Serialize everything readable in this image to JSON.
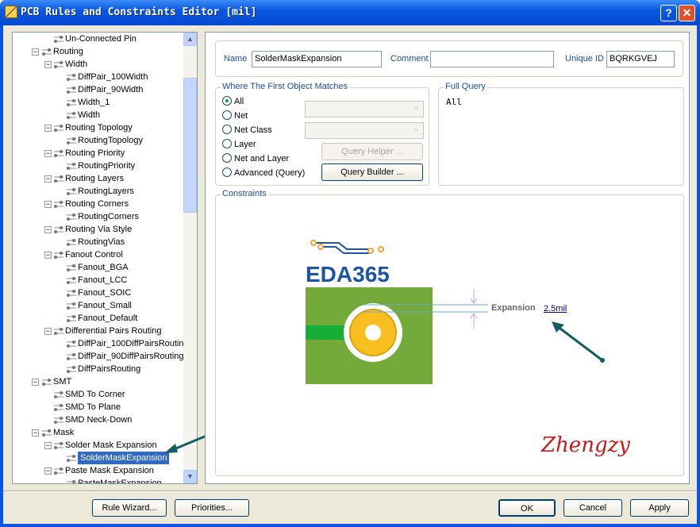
{
  "window": {
    "title": "PCB Rules and Constraints Editor [mil]",
    "help": "?",
    "close": "✕"
  },
  "tree": [
    {
      "label": "Un-Connected Pin",
      "level": 2,
      "leaf": true
    },
    {
      "label": "Routing",
      "level": 1
    },
    {
      "label": "Width",
      "level": 2
    },
    {
      "label": "DiffPair_100Width",
      "level": 3
    },
    {
      "label": "DiffPair_90Width",
      "level": 3
    },
    {
      "label": "Width_1",
      "level": 3
    },
    {
      "label": "Width",
      "level": 3
    },
    {
      "label": "Routing Topology",
      "level": 2
    },
    {
      "label": "RoutingTopology",
      "level": 3
    },
    {
      "label": "Routing Priority",
      "level": 2
    },
    {
      "label": "RoutingPriority",
      "level": 3
    },
    {
      "label": "Routing Layers",
      "level": 2
    },
    {
      "label": "RoutingLayers",
      "level": 3
    },
    {
      "label": "Routing Corners",
      "level": 2
    },
    {
      "label": "RoutingCorners",
      "level": 3
    },
    {
      "label": "Routing Via Style",
      "level": 2
    },
    {
      "label": "RoutingVias",
      "level": 3
    },
    {
      "label": "Fanout Control",
      "level": 2
    },
    {
      "label": "Fanout_BGA",
      "level": 3
    },
    {
      "label": "Fanout_LCC",
      "level": 3
    },
    {
      "label": "Fanout_SOIC",
      "level": 3
    },
    {
      "label": "Fanout_Small",
      "level": 3
    },
    {
      "label": "Fanout_Default",
      "level": 3
    },
    {
      "label": "Differential Pairs Routing",
      "level": 2
    },
    {
      "label": "DiffPair_100DiffPairsRoutin",
      "level": 3
    },
    {
      "label": "DiffPair_90DiffPairsRouting",
      "level": 3
    },
    {
      "label": "DiffPairsRouting",
      "level": 3
    },
    {
      "label": "SMT",
      "level": 1
    },
    {
      "label": "SMD To Corner",
      "level": 2,
      "leaf": true
    },
    {
      "label": "SMD To Plane",
      "level": 2,
      "leaf": true
    },
    {
      "label": "SMD Neck-Down",
      "level": 2,
      "leaf": true
    },
    {
      "label": "Mask",
      "level": 1
    },
    {
      "label": "Solder Mask Expansion",
      "level": 2
    },
    {
      "label": "SolderMaskExpansion",
      "level": 3,
      "selected": true
    },
    {
      "label": "Paste Mask Expansion",
      "level": 2
    },
    {
      "label": "PasteMaskExpansion",
      "level": 3
    }
  ],
  "rule": {
    "name_label": "Name",
    "name": "SolderMaskExpansion",
    "comment_label": "Comment",
    "comment": "",
    "uid_label": "Unique ID",
    "uid": "BQRKGVEJ"
  },
  "match": {
    "title": "Where The First Object Matches",
    "options": [
      "All",
      "Net",
      "Net Class",
      "Layer",
      "Net and Layer",
      "Advanced (Query)"
    ],
    "selected": "All",
    "query_helper": "Query Helper ...",
    "query_builder": "Query Builder ..."
  },
  "full_query": {
    "title": "Full Query",
    "text": "All"
  },
  "constraints": {
    "title": "Constraints",
    "expansion_label": "Expansion",
    "expansion_value": "2.5mil",
    "logo": "EDA365",
    "signature": "Zhengzy"
  },
  "footer": {
    "rule_wizard": "Rule Wizard...",
    "priorities": "Priorities...",
    "ok": "OK",
    "cancel": "Cancel",
    "apply": "Apply"
  },
  "colors": {
    "accent": "#1c4ea0",
    "board": "#73aa3a",
    "pad": "#f7c020",
    "arrow": "#155e63"
  }
}
